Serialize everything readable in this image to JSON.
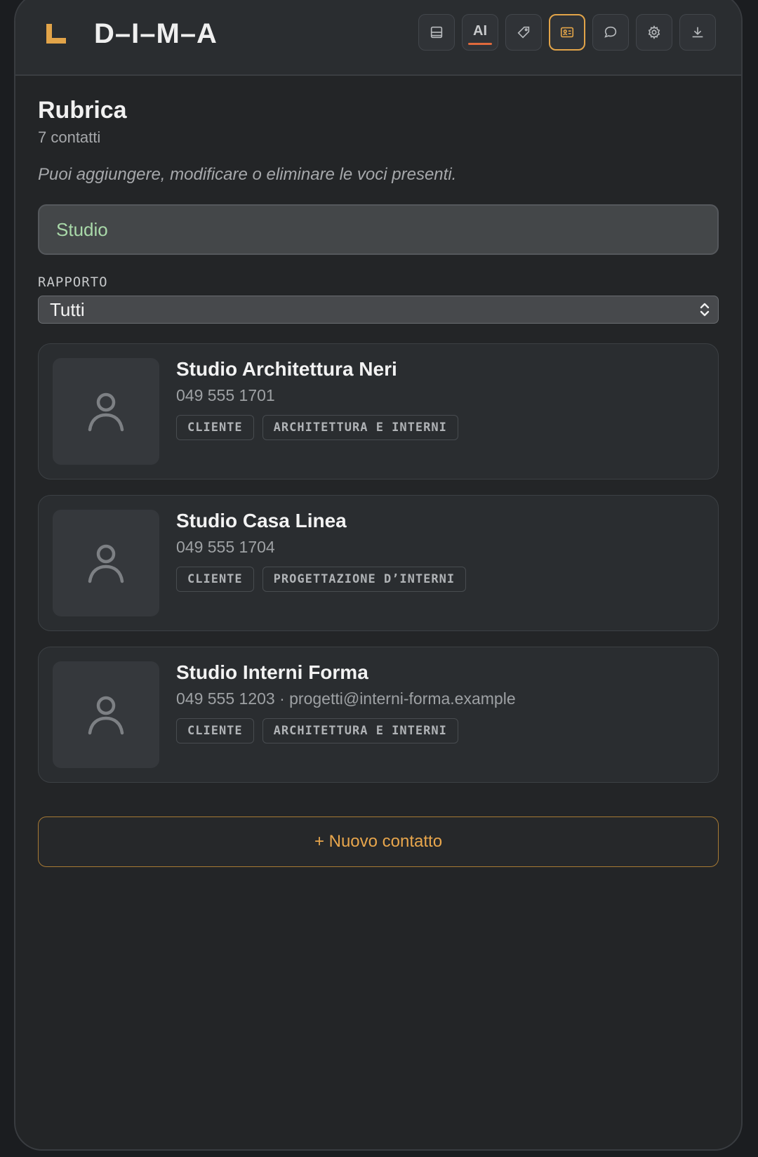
{
  "header": {
    "brand": "D–I–M–A",
    "toolbar": {
      "ai_label": "AI",
      "buttons": [
        "archive-icon",
        "ai-button",
        "tag-icon",
        "contacts-icon",
        "chat-icon",
        "gear-icon",
        "download-icon"
      ],
      "active": "contacts-icon"
    },
    "colors": {
      "accent": "#e2a449",
      "ai_underline": "#e06a3c"
    }
  },
  "main": {
    "title": "Rubrica",
    "count": "7 contatti",
    "hint": "Puoi aggiungere, modificare o eliminare le voci presenti.",
    "search": {
      "value": "Studio"
    },
    "filter": {
      "label": "RAPPORTO",
      "selected": "Tutti"
    },
    "contacts": [
      {
        "name": "Studio Architettura Neri",
        "details": "049 555 1701",
        "tags": [
          "CLIENTE",
          "ARCHITETTURA E INTERNI"
        ]
      },
      {
        "name": "Studio Casa Linea",
        "details": "049 555 1704",
        "tags": [
          "CLIENTE",
          "PROGETTAZIONE D’INTERNI"
        ]
      },
      {
        "name": "Studio Interni Forma",
        "details": "049 555 1203 · progetti@interni-forma.example",
        "tags": [
          "CLIENTE",
          "ARCHITETTURA E INTERNI"
        ]
      }
    ],
    "new_contact_label": "+ Nuovo contatto"
  }
}
